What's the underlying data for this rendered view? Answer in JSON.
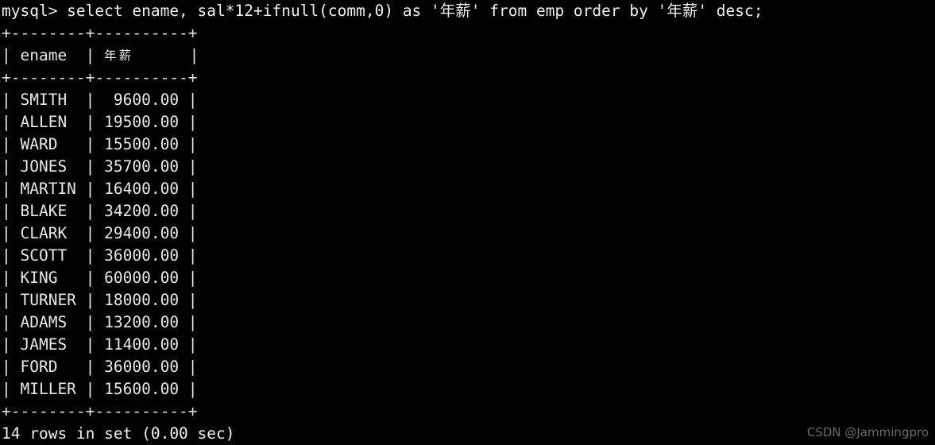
{
  "terminal": {
    "background_color": "#000000",
    "text_color": "#e8e8e8",
    "prompt": "mysql> ",
    "command": "select ename, sal*12+ifnull(comm,0) as '年薪' from emp order by '年薪' desc;",
    "command_full_line": "mysql> select ename, sal*12+ifnull(comm,0) as '年薪' from emp order by '年薪' desc;",
    "separator": "+--------+----------+",
    "header_prefix": "| ename  | ",
    "header_cjk": "年薪",
    "header_suffix": "      |",
    "columns": [
      "ename",
      "年薪"
    ],
    "rows": [
      {
        "line": "| SMITH  |  9600.00 |",
        "ename": "SMITH",
        "salary": "9600.00"
      },
      {
        "line": "| ALLEN  | 19500.00 |",
        "ename": "ALLEN",
        "salary": "19500.00"
      },
      {
        "line": "| WARD   | 15500.00 |",
        "ename": "WARD",
        "salary": "15500.00"
      },
      {
        "line": "| JONES  | 35700.00 |",
        "ename": "JONES",
        "salary": "35700.00"
      },
      {
        "line": "| MARTIN | 16400.00 |",
        "ename": "MARTIN",
        "salary": "16400.00"
      },
      {
        "line": "| BLAKE  | 34200.00 |",
        "ename": "BLAKE",
        "salary": "34200.00"
      },
      {
        "line": "| CLARK  | 29400.00 |",
        "ename": "CLARK",
        "salary": "29400.00"
      },
      {
        "line": "| SCOTT  | 36000.00 |",
        "ename": "SCOTT",
        "salary": "36000.00"
      },
      {
        "line": "| KING   | 60000.00 |",
        "ename": "KING",
        "salary": "60000.00"
      },
      {
        "line": "| TURNER | 18000.00 |",
        "ename": "TURNER",
        "salary": "18000.00"
      },
      {
        "line": "| ADAMS  | 13200.00 |",
        "ename": "ADAMS",
        "salary": "13200.00"
      },
      {
        "line": "| JAMES  | 11400.00 |",
        "ename": "JAMES",
        "salary": "11400.00"
      },
      {
        "line": "| FORD   | 36000.00 |",
        "ename": "FORD",
        "salary": "36000.00"
      },
      {
        "line": "| MILLER | 15600.00 |",
        "ename": "MILLER",
        "salary": "15600.00"
      }
    ],
    "status": "14 rows in set (0.00 sec)"
  },
  "watermark": {
    "text": "CSDN @Jammingpro",
    "color": "#6a6a6a"
  }
}
